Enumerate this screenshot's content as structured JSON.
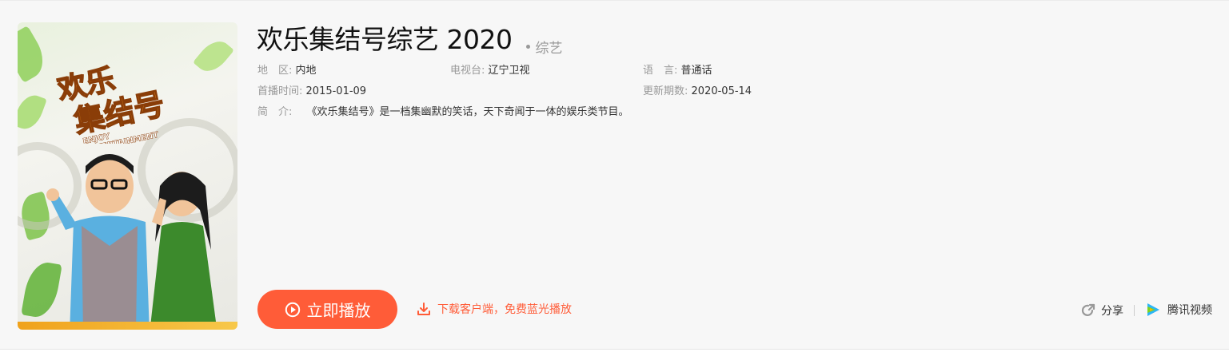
{
  "show": {
    "title": "欢乐集结号综艺 2020",
    "genre": "综艺",
    "poster_logo_cn": "欢乐集结号",
    "poster_logo_en_1": "ENJOY",
    "poster_logo_en_2": "ENTERTAINMENT"
  },
  "info": {
    "region_label": "地　区:",
    "region_value": "内地",
    "tv_label": "电视台:",
    "tv_value": "辽宁卫视",
    "lang_label": "语　言:",
    "lang_value": "普通话",
    "premiere_label": "首播时间:",
    "premiere_value": "2015-01-09",
    "update_label": "更新期数:",
    "update_value": "2020-05-14",
    "intro_label": "简　介:",
    "intro_value": "《欢乐集结号》是一档集幽默的笑话，天下奇闻于一体的娱乐类节目。"
  },
  "actions": {
    "play_label": "立即播放",
    "download_label": "下载客户端，免费蓝光播放",
    "share_label": "分享",
    "source_label": "腾讯视频"
  },
  "colors": {
    "accent": "#ff5c38",
    "background": "#f7f7f7"
  },
  "icons": {
    "play": "play-circle-icon",
    "download": "download-icon",
    "share": "share-icon",
    "source": "tencent-video-icon"
  }
}
